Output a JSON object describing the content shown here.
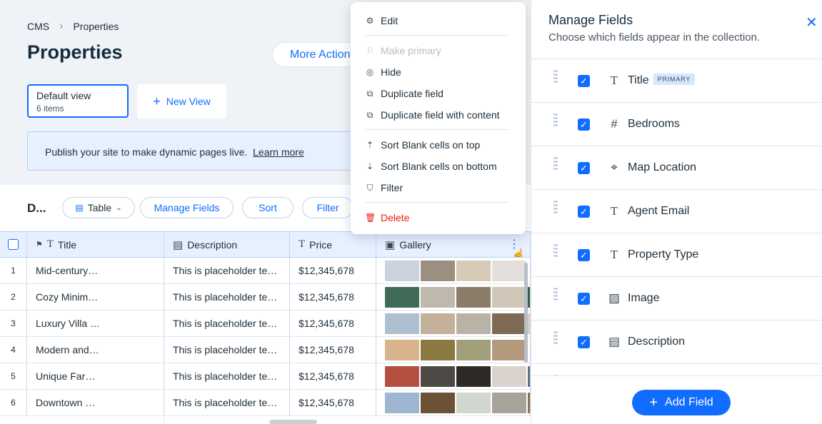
{
  "breadcrumb": {
    "root": "CMS",
    "current": "Properties"
  },
  "page_title": "Properties",
  "more_actions_label": "More Actions",
  "view": {
    "name": "Default view",
    "count": "6 items"
  },
  "new_view_label": "New View",
  "banner": {
    "text": "Publish your site to make dynamic pages live.",
    "link": "Learn more"
  },
  "toolbar": {
    "collection_short": "D...",
    "layout_label": "Table",
    "manage_fields_label": "Manage Fields",
    "sort_label": "Sort",
    "filter_label": "Filter"
  },
  "table": {
    "headers": [
      "Title",
      "Description",
      "Price",
      "Gallery"
    ],
    "rows": [
      {
        "num": "1",
        "title": "Mid-century…",
        "description": "This is placeholder te…",
        "price": "$12,345,678"
      },
      {
        "num": "2",
        "title": "Cozy Minim…",
        "description": "This is placeholder te…",
        "price": "$12,345,678"
      },
      {
        "num": "3",
        "title": "Luxury Villa …",
        "description": "This is placeholder te…",
        "price": "$12,345,678"
      },
      {
        "num": "4",
        "title": "Modern and…",
        "description": "This is placeholder te…",
        "price": "$12,345,678"
      },
      {
        "num": "5",
        "title": "Unique Far…",
        "description": "This is placeholder te…",
        "price": "$12,345,678"
      },
      {
        "num": "6",
        "title": "Downtown …",
        "description": "This is placeholder te…",
        "price": "$12,345,678"
      }
    ],
    "gallery_colors": [
      [
        "#c9d3dc",
        "#9a8f80",
        "#d7cbb8",
        "#e3e0db"
      ],
      [
        "#3f6b58",
        "#bfb8ac",
        "#8c7d6b",
        "#cfc6b8",
        "#2f5c4d"
      ],
      [
        "#aebfd0",
        "#c4b19a",
        "#b9b2a6",
        "#7e6a55",
        "#d8cfbf"
      ],
      [
        "#d8b48c",
        "#8a7a3f",
        "#a1a07a",
        "#b49a7c"
      ],
      [
        "#b4503f",
        "#4d4a45",
        "#2e2a28",
        "#d9d3cb",
        "#5f6f7c"
      ],
      [
        "#9fb6d0",
        "#6b5236",
        "#d1d7cf",
        "#a8a39a",
        "#8c6f54"
      ]
    ]
  },
  "menu": {
    "edit": "Edit",
    "make_primary": "Make primary",
    "hide": "Hide",
    "duplicate_field": "Duplicate field",
    "duplicate_with_content": "Duplicate field with content",
    "sort_top": "Sort Blank cells on top",
    "sort_bottom": "Sort Blank cells on bottom",
    "filter": "Filter",
    "delete": "Delete"
  },
  "panel": {
    "title": "Manage Fields",
    "subtitle": "Choose which fields appear in the collection.",
    "primary_badge": "PRIMARY",
    "fields": [
      {
        "name": "Title",
        "icon": "text-icon"
      },
      {
        "name": "Bedrooms",
        "icon": "number-icon"
      },
      {
        "name": "Map Location",
        "icon": "location-icon"
      },
      {
        "name": "Agent Email",
        "icon": "text-icon"
      },
      {
        "name": "Property Type",
        "icon": "text-icon"
      },
      {
        "name": "Image",
        "icon": "image-icon"
      },
      {
        "name": "Description",
        "icon": "document-icon"
      }
    ],
    "add_field_label": "Add Field"
  },
  "colors": {
    "accent": "#116dff",
    "danger": "#e62214",
    "header_bg": "#eff2f6"
  }
}
